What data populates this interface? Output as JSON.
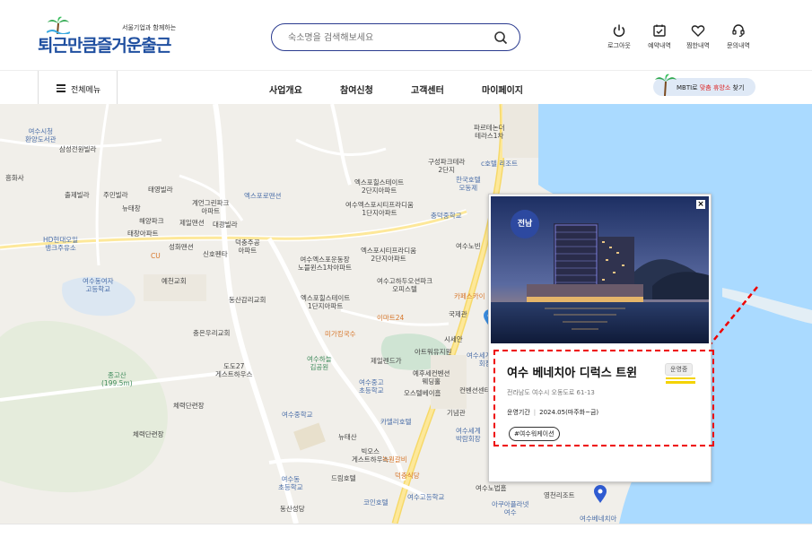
{
  "header": {
    "logo_subtitle": "서울기업과 함께하는",
    "logo_title": "퇴근만큼즐거운출근",
    "search_placeholder": "숙소명을 검색해보세요",
    "utilities": [
      {
        "label": "로그아웃",
        "icon": "power-icon"
      },
      {
        "label": "예약내역",
        "icon": "calendar-check-icon"
      },
      {
        "label": "찜한내역",
        "icon": "heart-icon"
      },
      {
        "label": "문의내역",
        "icon": "headset-icon"
      }
    ]
  },
  "nav": {
    "all_menu": "전체메뉴",
    "items": [
      "사업개요",
      "참여신청",
      "고객센터",
      "마이페이지"
    ],
    "mbti_prefix": "MBTI로",
    "mbti_highlight": "맞춤 휴양소",
    "mbti_suffix": "찾기"
  },
  "popup": {
    "region": "전남",
    "close": "×",
    "name": "여수 베네치아 디럭스 트윈",
    "status": "운영중",
    "address": "전라남도 여수시 오동도로 61-13",
    "period_label": "운영기간",
    "period_value": "2024.05(마주화~금)",
    "tag": "#여수워케이션"
  },
  "map_labels": [
    {
      "t": "여수시청\n환양도서관",
      "c": "blue"
    },
    {
      "t": "삼성전원빌라",
      "c": ""
    },
    {
      "t": "흥화사",
      "c": ""
    },
    {
      "t": "출제빌라",
      "c": ""
    },
    {
      "t": "주민빌라",
      "c": ""
    },
    {
      "t": "뉴태창",
      "c": ""
    },
    {
      "t": "태영빌라",
      "c": ""
    },
    {
      "t": "해양파크",
      "c": ""
    },
    {
      "t": "태창아파트",
      "c": ""
    },
    {
      "t": "제일맨션",
      "c": ""
    },
    {
      "t": "대광빌라",
      "c": ""
    },
    {
      "t": "계언그린파크\n아파트",
      "c": ""
    },
    {
      "t": "엑스포로맨션",
      "c": "blue"
    },
    {
      "t": "덕충주공\n아파트",
      "c": ""
    },
    {
      "t": "HD현대오일\n뱅크주유소",
      "c": "blue"
    },
    {
      "t": "CU",
      "c": "orange"
    },
    {
      "t": "성화맨션",
      "c": ""
    },
    {
      "t": "신호펜타",
      "c": ""
    },
    {
      "t": "예천교회",
      "c": ""
    },
    {
      "t": "여수동여자\n고등학교",
      "c": "blue"
    },
    {
      "t": "동산감리교회",
      "c": ""
    },
    {
      "t": "충은우리교회",
      "c": ""
    },
    {
      "t": "도도27\n게스트하우스",
      "c": ""
    },
    {
      "t": "종고산\n(199.5m)",
      "c": "green"
    },
    {
      "t": "체력단련장",
      "c": ""
    },
    {
      "t": "체력단련장",
      "c": ""
    },
    {
      "t": "엑스포힐스테이트\n2단지아파트",
      "c": ""
    },
    {
      "t": "여수엑스포시티프라디움\n1단지아파트",
      "c": ""
    },
    {
      "t": "엑스포시티프라디움\n2단지아파트",
      "c": ""
    },
    {
      "t": "여수엑스포운동장\n노블윈스1차아파트",
      "c": ""
    },
    {
      "t": "여수고하두오션파크\n오피스텔",
      "c": ""
    },
    {
      "t": "엑스포힐스테이트\n1단지아파트",
      "c": ""
    },
    {
      "t": "이마트24",
      "c": "orange"
    },
    {
      "t": "미가킹국수",
      "c": "orange"
    },
    {
      "t": "여수하늘\n김공원",
      "c": "green"
    },
    {
      "t": "제일렌드가",
      "c": ""
    },
    {
      "t": "여수중고\n초등학교",
      "c": "blue"
    },
    {
      "t": "오스텔베이흠",
      "c": ""
    },
    {
      "t": "여수중학교",
      "c": "blue"
    },
    {
      "t": "카델리호텔",
      "c": "blue"
    },
    {
      "t": "뉴태산",
      "c": ""
    },
    {
      "t": "빅오스\n게스트하우스",
      "c": ""
    },
    {
      "t": "드림호텔",
      "c": ""
    },
    {
      "t": "녹원갈비",
      "c": "orange"
    },
    {
      "t": "덕충식당",
      "c": "orange"
    },
    {
      "t": "여수고등학교",
      "c": "blue"
    },
    {
      "t": "코인호텔",
      "c": "blue"
    },
    {
      "t": "여수동\n초등학교",
      "c": "blue"
    },
    {
      "t": "동산성당",
      "c": ""
    },
    {
      "t": "파르테논더\n테라스1차",
      "c": ""
    },
    {
      "t": "구성파크테라\n2단지",
      "c": ""
    },
    {
      "t": "c호텔 리조트",
      "c": "blue"
    },
    {
      "t": "한국호텔\n모동제",
      "c": "blue"
    },
    {
      "t": "충덕중학교",
      "c": "blue"
    },
    {
      "t": "여수노빈",
      "c": ""
    },
    {
      "t": "카페스카이",
      "c": "orange"
    },
    {
      "t": "국제관",
      "c": ""
    },
    {
      "t": "시세안",
      "c": ""
    },
    {
      "t": "아트워유지원",
      "c": ""
    },
    {
      "t": "여수세계박람\n회장",
      "c": "blue"
    },
    {
      "t": "예후세컨벤션\n웨딩홀",
      "c": ""
    },
    {
      "t": "컨벤션센터",
      "c": ""
    },
    {
      "t": "기념관",
      "c": ""
    },
    {
      "t": "여수세계\n박람회장",
      "c": "blue"
    },
    {
      "t": "여수노법홈",
      "c": ""
    },
    {
      "t": "영천리조트",
      "c": ""
    },
    {
      "t": "아쿠아플라넷\n여수",
      "c": "blue"
    },
    {
      "t": "여수베네치아",
      "c": "blue"
    }
  ]
}
